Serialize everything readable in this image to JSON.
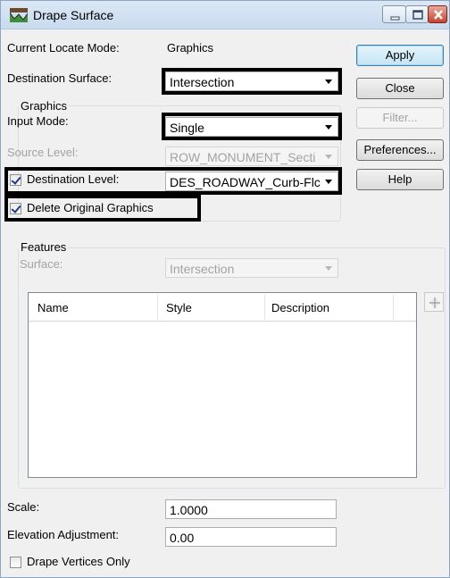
{
  "window": {
    "title": "Drape Surface",
    "icon": "drape-surface-app-icon"
  },
  "locate": {
    "label": "Current Locate Mode:",
    "value": "Graphics"
  },
  "destination_surface": {
    "label": "Destination Surface:",
    "value": "Intersection"
  },
  "graphics": {
    "group_label": "Graphics",
    "input_mode": {
      "label": "Input Mode:",
      "value": "Single"
    },
    "source_level": {
      "label": "Source Level:",
      "value": "ROW_MONUMENT_Secti"
    },
    "destination_level": {
      "label": "Destination Level:",
      "value": "DES_ROADWAY_Curb-Flc",
      "checked": true
    },
    "delete_original": {
      "label": "Delete Original Graphics",
      "checked": true
    }
  },
  "buttons": {
    "apply": "Apply",
    "close": "Close",
    "filter": "Filter...",
    "preferences": "Preferences...",
    "help": "Help"
  },
  "features": {
    "group_label": "Features",
    "surface": {
      "label": "Surface:",
      "value": "Intersection"
    },
    "columns": [
      "Name",
      "Style",
      "Description"
    ],
    "rows": []
  },
  "scale": {
    "label": "Scale:",
    "value": "1.0000"
  },
  "elevation": {
    "label": "Elevation Adjustment:",
    "value": "0.00"
  },
  "drape_vertices": {
    "label": "Drape Vertices Only",
    "checked": false
  },
  "colors": {
    "highlight": "#000000",
    "titlebar": "#c9dbef",
    "close_button": "#c8442c"
  }
}
